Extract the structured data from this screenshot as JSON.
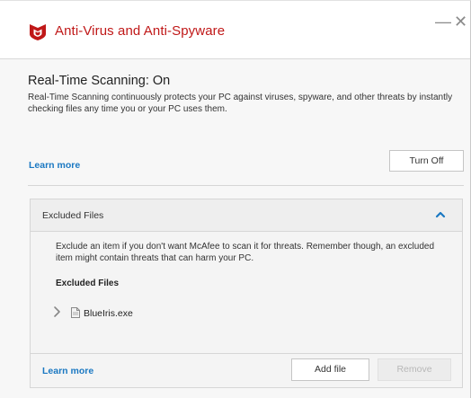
{
  "window": {
    "title": "Anti-Virus and Anti-Spyware",
    "minimize_label": "—",
    "close_label": "✕",
    "brand_color": "#c01818"
  },
  "scanning": {
    "title": "Real-Time Scanning: On",
    "description": "Real-Time Scanning continuously protects your PC against viruses, spyware, and other threats by instantly checking files any time you or your PC uses them.",
    "learn_more": "Learn more",
    "turn_off_label": "Turn Off"
  },
  "excluded_panel": {
    "header": "Excluded Files",
    "description": "Exclude an item if you don't want McAfee to scan it for threats. Remember though, an excluded item might contain threats that can harm your PC.",
    "list_label": "Excluded Files",
    "files": [
      {
        "name": "BlueIris.exe",
        "icon": "file-icon"
      }
    ],
    "learn_more": "Learn more",
    "add_file_label": "Add file",
    "remove_label": "Remove"
  },
  "colors": {
    "link": "#1a78c2",
    "disabled_text": "#b8b8b8"
  }
}
